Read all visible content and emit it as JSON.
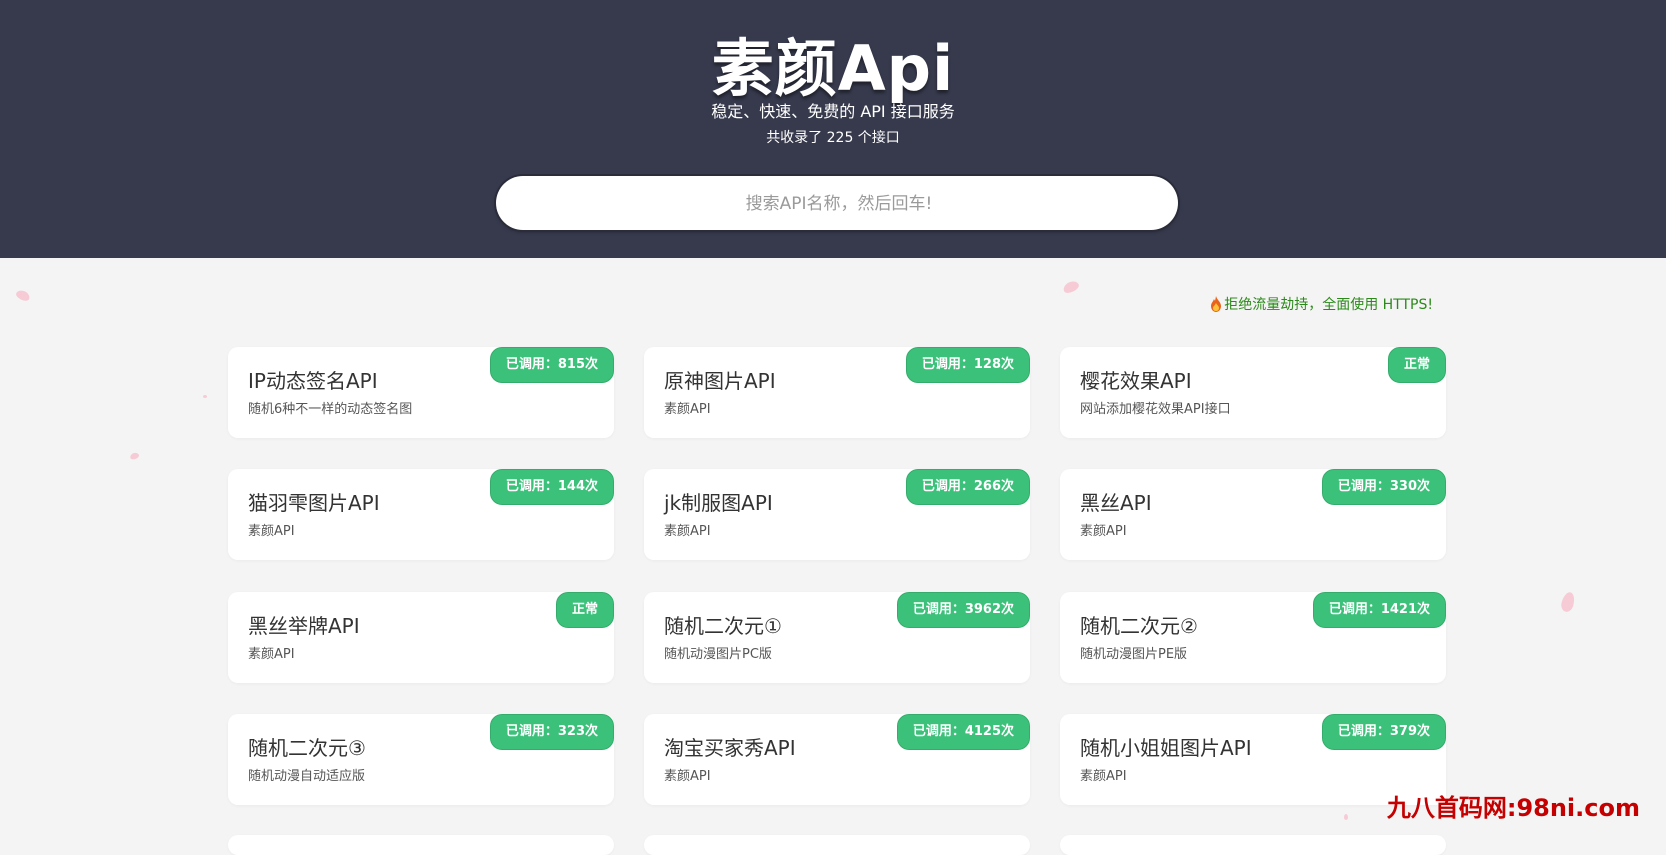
{
  "header": {
    "title": "素颜Api",
    "subtitle": "稳定、快速、免费的 API 接口服务",
    "count": "共收录了 225 个接口"
  },
  "search": {
    "placeholder": "搜索API名称，然后回车!",
    "value": ""
  },
  "notice": {
    "icon": "fire-icon",
    "text": "拒绝流量劫持，全面使用 HTTPS!"
  },
  "cards": [
    {
      "title": "IP动态签名API",
      "desc": "随机6种不一样的动态签名图",
      "badge": "已调用：815次"
    },
    {
      "title": "原神图片API",
      "desc": "素颜API",
      "badge": "已调用：128次"
    },
    {
      "title": "樱花效果API",
      "desc": "网站添加樱花效果API接口",
      "badge": "正常"
    },
    {
      "title": "猫羽雫图片API",
      "desc": "素颜API",
      "badge": "已调用：144次"
    },
    {
      "title": "jk制服图API",
      "desc": "素颜API",
      "badge": "已调用：266次"
    },
    {
      "title": "黑丝API",
      "desc": "素颜API",
      "badge": "已调用：330次"
    },
    {
      "title": "黑丝举牌API",
      "desc": "素颜API",
      "badge": "正常"
    },
    {
      "title": "随机二次元①",
      "desc": "随机动漫图片PC版",
      "badge": "已调用：3962次"
    },
    {
      "title": "随机二次元②",
      "desc": "随机动漫图片PE版",
      "badge": "已调用：1421次"
    },
    {
      "title": "随机二次元③",
      "desc": "随机动漫自动适应版",
      "badge": "已调用：323次"
    },
    {
      "title": "淘宝买家秀API",
      "desc": "素颜API",
      "badge": "已调用：4125次"
    },
    {
      "title": "随机小姐姐图片API",
      "desc": "素颜API",
      "badge": "已调用：379次"
    }
  ],
  "watermark": "九八首码网:98ni.com",
  "colors": {
    "header_bg": "#373a4d",
    "page_bg": "#f4f4f4",
    "badge_bg": "#3cc17a",
    "notice_text": "#2b8a1a",
    "watermark": "#c40000"
  }
}
